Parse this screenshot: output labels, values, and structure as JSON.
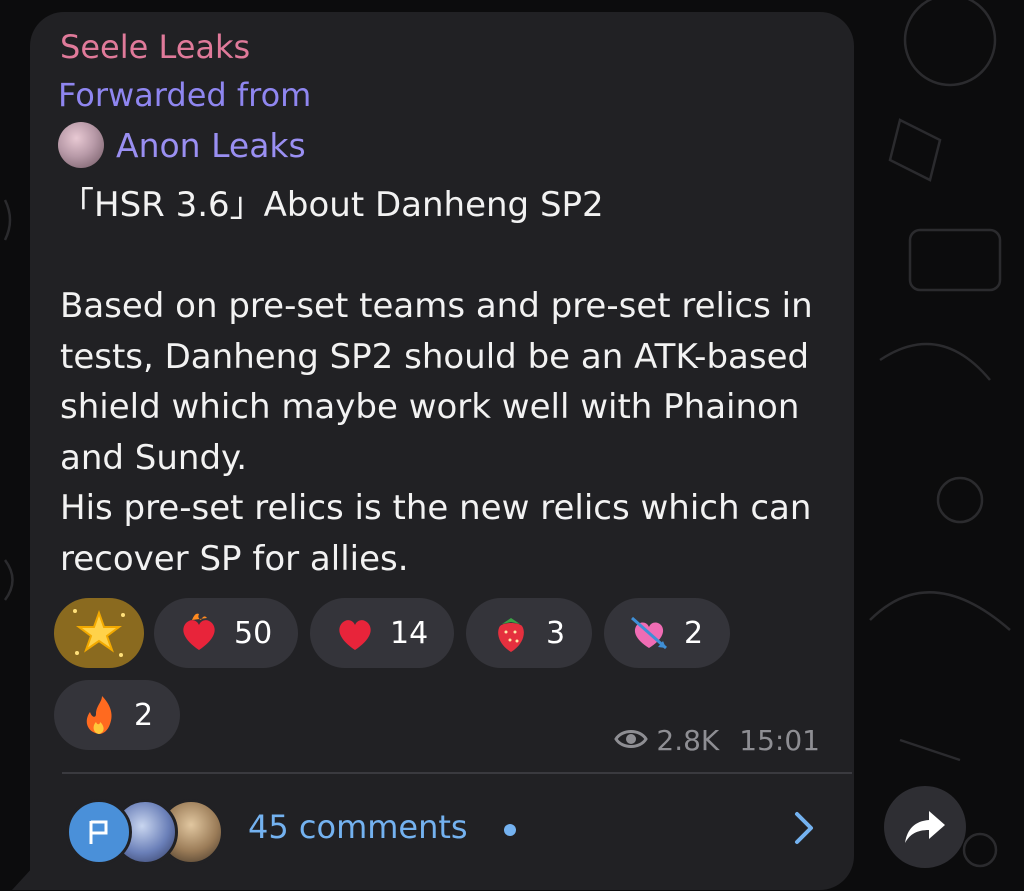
{
  "post": {
    "channel_name": "Seele Leaks",
    "forwarded_label": "Forwarded from",
    "forwarded_source": "Anon Leaks",
    "text": "「HSR 3.6」About Danheng SP2\n\nBased on pre-set teams and pre-set relics in tests, Danheng SP2 should be an ATK-based shield which maybe work well with Phainon and Sundy.\nHis pre-set relics is the new relics which can recover SP for allies."
  },
  "reactions": [
    {
      "icon": "star-sparkle-icon",
      "count": ""
    },
    {
      "icon": "heart-on-fire-icon",
      "count": "50"
    },
    {
      "icon": "red-heart-icon",
      "count": "14"
    },
    {
      "icon": "strawberry-icon",
      "count": "3"
    },
    {
      "icon": "heart-with-arrow-icon",
      "count": "2"
    },
    {
      "icon": "fire-icon",
      "count": "2"
    }
  ],
  "meta": {
    "views": "2.8K",
    "time": "15:01"
  },
  "comments": {
    "label": "45 comments"
  },
  "colors": {
    "channel_name": "#e07a9a",
    "forwarded": "#8f86f0",
    "link": "#74b2f0",
    "bubble": "#212124",
    "background": "#0c0c0d"
  }
}
